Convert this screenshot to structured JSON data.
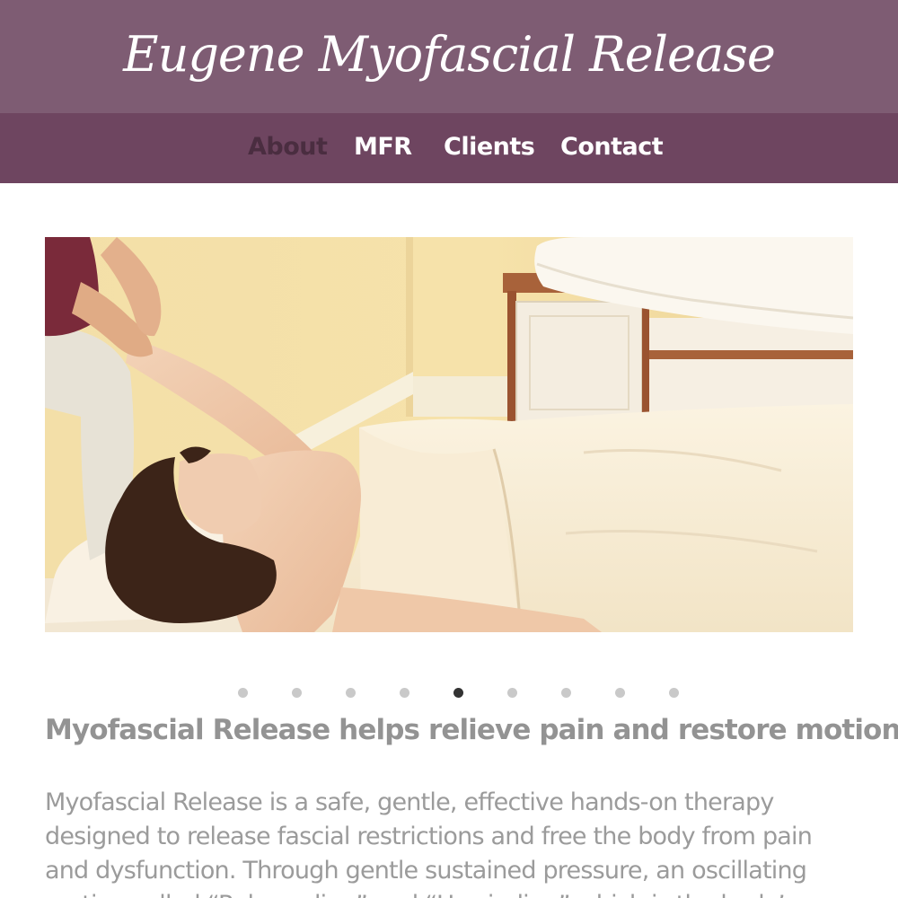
{
  "site": {
    "title": "Eugene Myofascial Release"
  },
  "nav": {
    "items": [
      {
        "label": "About",
        "active": true
      },
      {
        "label": "MFR",
        "active": false
      },
      {
        "label": "Clients",
        "active": false
      },
      {
        "label": "Contact",
        "active": false
      }
    ]
  },
  "hero": {
    "image": "massage-therapy-photo"
  },
  "carousel": {
    "slide_count": 9,
    "active_slide": 5
  },
  "content": {
    "heading": "Myofascial Release helps relieve pain and restore motion",
    "intro": "Myofascial Release is a safe, gentle, effective hands-on therapy designed to release fascial restrictions and free the body from pain and dysfunction. Through gentle sustained pressure, an oscillating motion called “Rebounding” and “Unwinding” which is the body’s"
  },
  "colors": {
    "header_bg": "#7e5c73",
    "nav_bg": "#6e4560",
    "nav_active": "#4a2d40",
    "nav_text": "#ffffff",
    "heading_text": "#939393",
    "body_text": "#9b9b9b",
    "dot_inactive": "#c9c9c9",
    "dot_active": "#333333"
  }
}
